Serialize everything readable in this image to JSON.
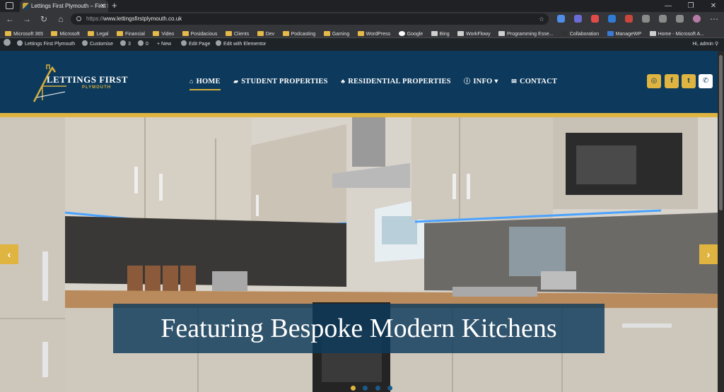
{
  "browser": {
    "tab_title": "Lettings First Plymouth – First fo",
    "tab_close": "✕",
    "new_tab": "+",
    "window_controls": [
      "—",
      "❐",
      "✕"
    ],
    "url_prefix": "https://",
    "url_host": "www.lettingsfirstplymouth.co.uk",
    "bookmarks": [
      "Microsoft 365",
      "Microsoft",
      "Legal",
      "Financial",
      "Video",
      "Posidacious",
      "Clients",
      "Dev",
      "Podcasting",
      "Gaming",
      "WordPress",
      "Google",
      "Bing",
      "WorkFlowy",
      "Programming Esse...",
      "Collaboration",
      "ManageWP",
      "Home - Microsoft A..."
    ]
  },
  "admin_bar": {
    "site_name": "Lettings First Plymouth",
    "customise": "Customise",
    "updates_count": "3",
    "comments_count": "0",
    "new": "+ New",
    "edit_page": "Edit Page",
    "elementor": "Edit with Elementor",
    "greeting": "Hi, admin"
  },
  "header": {
    "logo_brand": "LETTINGS FIRST",
    "logo_sub": "PLYMOUTH",
    "nav": [
      {
        "label": "HOME",
        "icon": "⌂"
      },
      {
        "label": "STUDENT PROPERTIES",
        "icon": "▰"
      },
      {
        "label": "RESIDENTIAL PROPERTIES",
        "icon": "♣"
      },
      {
        "label": "INFO ▾",
        "icon": "ⓘ"
      },
      {
        "label": "CONTACT",
        "icon": "✉"
      }
    ],
    "social": [
      {
        "name": "instagram-icon",
        "glyph": "◎"
      },
      {
        "name": "facebook-icon",
        "glyph": "f"
      },
      {
        "name": "twitter-icon",
        "glyph": "t"
      },
      {
        "name": "phone-icon",
        "glyph": "✆"
      }
    ]
  },
  "hero": {
    "caption": "Featuring Bespoke Modern Kitchens",
    "prev": "‹",
    "next": "›",
    "slides": 4,
    "active_slide": 1
  },
  "colors": {
    "navy": "#0d3a5c",
    "gold": "#e0b440"
  }
}
